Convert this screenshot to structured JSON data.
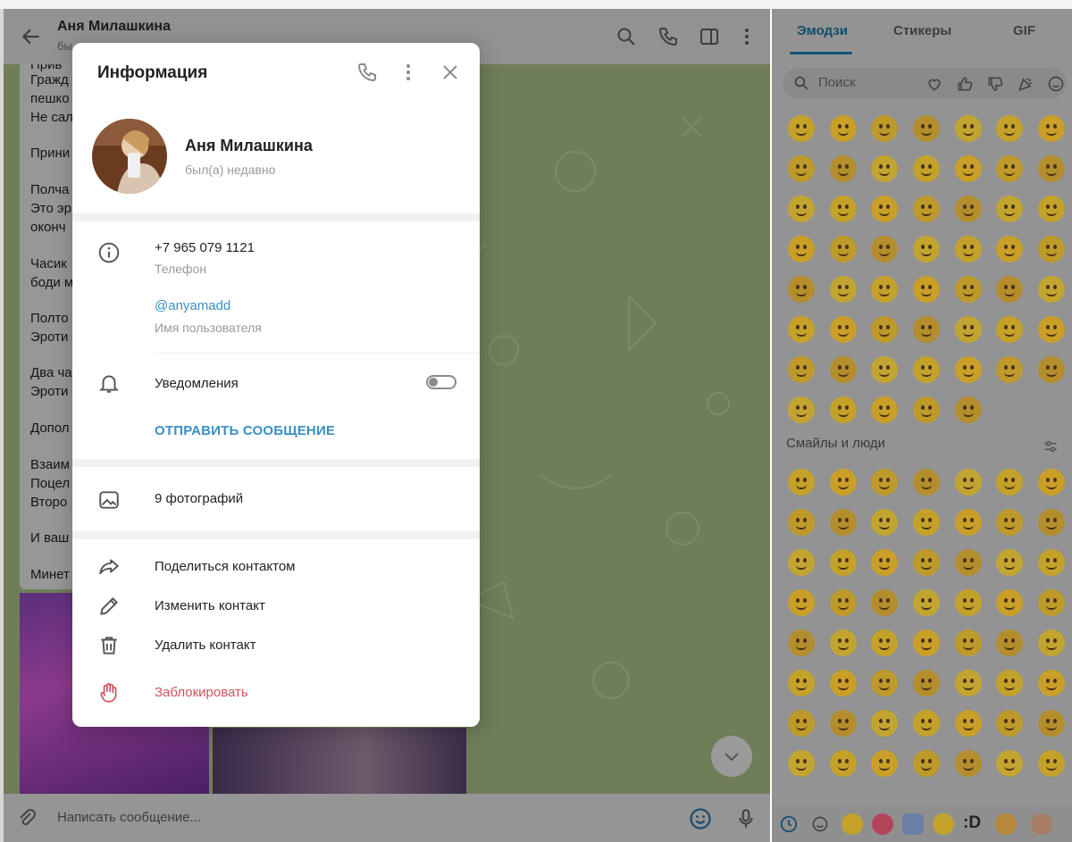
{
  "chat": {
    "title": "Аня Милашкина",
    "subtitle": "бы",
    "message_fragments": [
      "Прив",
      "Гражд",
      "пешко",
      "Не сал",
      "Прини",
      "Полча",
      "Это эр",
      "оконч",
      "Часик",
      "боди м",
      "Полто",
      "Эроти",
      "Два ча",
      "Эроти",
      "Допол",
      "Взаим",
      "Поцел",
      "Второ",
      "И ваш",
      "Минет"
    ],
    "composer_placeholder": "Написать сообщение..."
  },
  "emoji_panel": {
    "tabs": [
      "Эмодзи",
      "Стикеры",
      "GIF"
    ],
    "active_tab": "Эмодзи",
    "search_placeholder": "Поиск",
    "section_title": "Смайлы и люди",
    "bottom_text_emoji": ":D"
  },
  "modal": {
    "title": "Информация",
    "name": "Аня Милашкина",
    "status": "был(а) недавно",
    "phone": "+7 965 079 1121",
    "phone_label": "Телефон",
    "username": "@anyamadd",
    "username_label": "Имя пользователя",
    "notifications_label": "Уведомления",
    "notifications_on": false,
    "send_message": "ОТПРАВИТЬ СООБЩЕНИЕ",
    "photos": "9 фотографий",
    "share": "Поделиться контактом",
    "edit": "Изменить контакт",
    "delete": "Удалить контакт",
    "block": "Заблокировать"
  },
  "colors": {
    "accent": "#3b8fc4",
    "danger": "#d0545f",
    "emoji_yellow": "#c4a22a"
  }
}
